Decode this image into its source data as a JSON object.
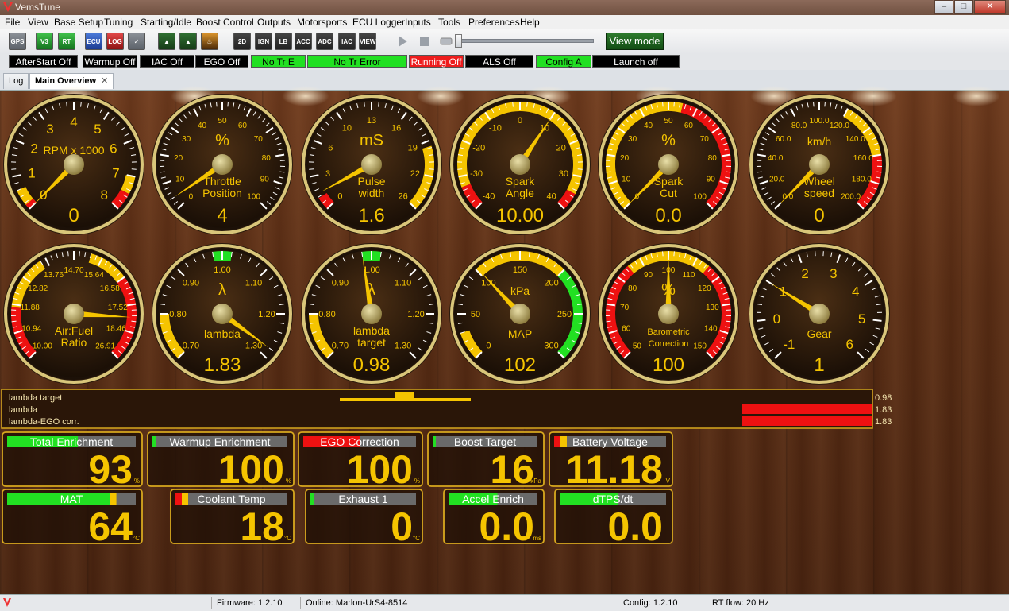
{
  "window": {
    "title": "VemsTune"
  },
  "menu": [
    "File",
    "View",
    "Base Setup",
    "Tuning",
    "Starting/Idle",
    "Boost Control",
    "Outputs",
    "Motorsports",
    "ECU Logger",
    "Inputs",
    "Tools",
    "Preferences",
    "Help"
  ],
  "toolbar": {
    "buttons": [
      {
        "name": "gps-button",
        "label": "GPS",
        "style": "grey"
      },
      {
        "name": "v3-button",
        "label": "V3",
        "style": "green"
      },
      {
        "name": "rt-button",
        "label": "RT",
        "style": "green"
      },
      {
        "name": "ecu-button",
        "label": "ECU",
        "style": "blue"
      },
      {
        "name": "log-button",
        "label": "LOG",
        "style": "red"
      },
      {
        "name": "check-button",
        "label": "✓",
        "style": "grey"
      },
      {
        "name": "tool-a-button",
        "label": "▲",
        "style": "darkgreen"
      },
      {
        "name": "tool-b-button",
        "label": "▲",
        "style": "darkgreen"
      },
      {
        "name": "fire-button",
        "label": "♨",
        "style": "fire"
      },
      {
        "name": "table-2d-button",
        "label": "2D",
        "style": "dark"
      },
      {
        "name": "table-ign-button",
        "label": "IGN",
        "style": "dark"
      },
      {
        "name": "table-lb-button",
        "label": "LB",
        "style": "dark"
      },
      {
        "name": "table-acc-button",
        "label": "ACC",
        "style": "dark"
      },
      {
        "name": "table-warm-button",
        "label": "ADC",
        "style": "dark"
      },
      {
        "name": "table-iac-button",
        "label": "IAC",
        "style": "dark"
      },
      {
        "name": "table-view-button",
        "label": "VIEW",
        "style": "dark"
      }
    ],
    "view_mode": "View mode"
  },
  "status_indicators": [
    {
      "label": "AfterStart Off",
      "color": "black"
    },
    {
      "label": "Warmup Off",
      "color": "black"
    },
    {
      "label": "IAC Off",
      "color": "black"
    },
    {
      "label": "EGO Off",
      "color": "black"
    },
    {
      "label": "No Tr E",
      "color": "green"
    },
    {
      "label": "No Tr Error",
      "color": "green"
    },
    {
      "label": "Running Off",
      "color": "red"
    },
    {
      "label": "ALS Off",
      "color": "black"
    },
    {
      "label": "Config A",
      "color": "green"
    },
    {
      "label": "Launch off",
      "color": "black"
    }
  ],
  "tabs": [
    {
      "label": "Log",
      "active": false
    },
    {
      "label": "Main Overview",
      "active": true,
      "close": "✕"
    }
  ],
  "gauges": [
    {
      "id": "rpm",
      "label": [
        "RPM x 1000"
      ],
      "unit": "",
      "ticks": [
        "0",
        "1",
        "2",
        "3",
        "4",
        "5",
        "6",
        "7",
        "8"
      ],
      "min": 0,
      "max": 8,
      "value": 0,
      "value_text": "0",
      "labelPos": "top",
      "arcs": [
        {
          "from": 0,
          "to": 0.6,
          "color": "#f5c400"
        },
        {
          "from": 0,
          "to": 0.15,
          "color": "#e11"
        },
        {
          "from": 7,
          "to": 7.5,
          "color": "#f5c400"
        },
        {
          "from": 7.5,
          "to": 8,
          "color": "#e11"
        }
      ]
    },
    {
      "id": "throttle",
      "label": [
        "Throttle",
        "Position"
      ],
      "unit": "%",
      "ticks": [
        "0",
        "10",
        "20",
        "30",
        "40",
        "50",
        "60",
        "70",
        "80",
        "90",
        "100"
      ],
      "min": 0,
      "max": 100,
      "value": 4,
      "value_text": "4",
      "labelPos": "bottom",
      "arcs": []
    },
    {
      "id": "pulse",
      "label": [
        "Pulse",
        "width"
      ],
      "unit": "mS",
      "ticks": [
        "0",
        "3",
        "6",
        "10",
        "13",
        "16",
        "19",
        "22",
        "26"
      ],
      "min": 0,
      "max": 26,
      "value": 1.6,
      "value_text": "1.6",
      "labelPos": "bottom",
      "arcs": [
        {
          "from": 0,
          "to": 1.2,
          "color": "#e11"
        },
        {
          "from": 20,
          "to": 26,
          "color": "#f5c400"
        }
      ]
    },
    {
      "id": "spark",
      "label": [
        "Spark",
        "Angle"
      ],
      "unit": "",
      "ticks": [
        "-40",
        "-30",
        "-20",
        "-10",
        "0",
        "10",
        "20",
        "30",
        "40"
      ],
      "min": -40,
      "max": 40,
      "value": 10,
      "value_text": "10.00",
      "labelPos": "bottom",
      "arcs": [
        {
          "from": -40,
          "to": -33,
          "color": "#e11"
        },
        {
          "from": -33,
          "to": 35,
          "color": "#f5c400"
        },
        {
          "from": 35,
          "to": 40,
          "color": "#e11"
        }
      ]
    },
    {
      "id": "sparkcut",
      "label": [
        "Spark",
        "Cut"
      ],
      "unit": "%",
      "ticks": [
        "0",
        "10",
        "20",
        "30",
        "40",
        "50",
        "60",
        "70",
        "80",
        "90",
        "100"
      ],
      "min": 0,
      "max": 100,
      "value": 0,
      "value_text": "0.0",
      "labelPos": "bottom",
      "arcs": [
        {
          "from": 0,
          "to": 55,
          "color": "#f5c400"
        },
        {
          "from": 55,
          "to": 100,
          "color": "#e11"
        }
      ]
    },
    {
      "id": "wheel",
      "label": [
        "Wheel",
        "speed"
      ],
      "unit": "km/h",
      "ticks": [
        "0.0",
        "20.0",
        "40.0",
        "60.0",
        "80.0",
        "100.0",
        "120.0",
        "140.0",
        "160.0",
        "180.0",
        "200.0"
      ],
      "min": 0,
      "max": 200,
      "value": 0,
      "value_text": "0",
      "labelPos": "bottom",
      "arcs": [
        {
          "from": 120,
          "to": 160,
          "color": "#f5c400"
        },
        {
          "from": 160,
          "to": 200,
          "color": "#e11"
        }
      ]
    },
    {
      "id": "afr",
      "label": [
        "Air:Fuel",
        "Ratio"
      ],
      "unit": "",
      "ticks": [
        "10.00",
        "10.94",
        "11.88",
        "12.82",
        "13.76",
        "14.70",
        "15.64",
        "16.58",
        "17.52",
        "18.46",
        "26.91"
      ],
      "min": 10,
      "max": 20,
      "value": 18.46,
      "value_text": "",
      "labelPos": "bottom",
      "arcs": [
        {
          "from": 10,
          "to": 11.9,
          "color": "#e11"
        },
        {
          "from": 11.9,
          "to": 13.8,
          "color": "#f5c400"
        },
        {
          "from": 15.6,
          "to": 17,
          "color": "#f5c400"
        },
        {
          "from": 17,
          "to": 20,
          "color": "#e11"
        }
      ]
    },
    {
      "id": "lambda",
      "label": [
        "lambda"
      ],
      "unit": "λ",
      "ticks": [
        "0.70",
        "0.80",
        "0.90",
        "1.00",
        "1.10",
        "1.20",
        "1.30"
      ],
      "min": 0.7,
      "max": 1.3,
      "value": 1.28,
      "value_text": "1.83",
      "labelPos": "bottom",
      "arcs": [
        {
          "from": 0.7,
          "to": 0.8,
          "color": "#f5c400"
        },
        {
          "from": 0.98,
          "to": 1.02,
          "color": "#22e022"
        }
      ]
    },
    {
      "id": "lambdatarget",
      "label": [
        "lambda",
        "target"
      ],
      "unit": "λ",
      "ticks": [
        "0.70",
        "0.80",
        "0.90",
        "1.00",
        "1.10",
        "1.20",
        "1.30"
      ],
      "min": 0.7,
      "max": 1.3,
      "value": 0.98,
      "value_text": "0.98",
      "labelPos": "bottom",
      "arcs": [
        {
          "from": 0.7,
          "to": 0.8,
          "color": "#f5c400"
        },
        {
          "from": 0.98,
          "to": 1.02,
          "color": "#22e022"
        }
      ]
    },
    {
      "id": "map",
      "label": [
        "MAP"
      ],
      "unit": "kPa",
      "ticks": [
        "0",
        "50",
        "100",
        "150",
        "200",
        "250",
        "300"
      ],
      "min": 0,
      "max": 300,
      "value": 102,
      "value_text": "102",
      "labelPos": "bottom",
      "arcs": [
        {
          "from": 0,
          "to": 30,
          "color": "#f5c400"
        },
        {
          "from": 100,
          "to": 200,
          "color": "#f5c400"
        },
        {
          "from": 200,
          "to": 300,
          "color": "#22e022"
        }
      ]
    },
    {
      "id": "baro",
      "label": [
        "Barometric",
        "Correction"
      ],
      "unit": "%",
      "ticks": [
        "50",
        "60",
        "70",
        "80",
        "90",
        "100",
        "110",
        "120",
        "130",
        "140",
        "150"
      ],
      "min": 50,
      "max": 150,
      "value": 100,
      "value_text": "100",
      "labelPos": "bottom",
      "arcs": [
        {
          "from": 50,
          "to": 85,
          "color": "#e11"
        },
        {
          "from": 85,
          "to": 115,
          "color": "#f5c400"
        },
        {
          "from": 115,
          "to": 150,
          "color": "#e11"
        }
      ]
    },
    {
      "id": "gear",
      "label": [
        "Gear"
      ],
      "unit": "",
      "ticks": [
        "-1",
        "0",
        "1",
        "2",
        "3",
        "4",
        "5",
        "6"
      ],
      "min": -1,
      "max": 6,
      "value": 1,
      "value_text": "1",
      "labelPos": "bottom",
      "arcs": []
    }
  ],
  "bars": {
    "rows": [
      {
        "label": "lambda target",
        "value": "0.98"
      },
      {
        "label": "lambda",
        "value": "1.83"
      },
      {
        "label": "lambda-EGO corr.",
        "value": "1.83"
      }
    ]
  },
  "numeric_boxes": [
    {
      "name": "total-enrichment",
      "label": "Total Enrichment",
      "value": "93",
      "unit": "%",
      "bar": "green"
    },
    {
      "name": "warmup-enrichment",
      "label": "Warmup Enrichment",
      "value": "100",
      "unit": "%",
      "bar": "grey"
    },
    {
      "name": "ego-correction",
      "label": "EGO Correction",
      "value": "100",
      "unit": "%",
      "bar": "red"
    },
    {
      "name": "boost-target",
      "label": "Boost Target",
      "value": "16",
      "unit": "kPa",
      "bar": "grey"
    },
    {
      "name": "battery-voltage",
      "label": "Battery Voltage",
      "value": "11.18",
      "unit": "V",
      "bar": "redyellow"
    },
    {
      "name": "mat",
      "label": "MAT",
      "value": "64",
      "unit": "°C",
      "bar": "greenyellow"
    },
    {
      "name": "coolant-temp",
      "label": "Coolant Temp",
      "value": "18",
      "unit": "°C",
      "bar": "redyellow"
    },
    {
      "name": "exhaust-1",
      "label": "Exhaust 1",
      "value": "0",
      "unit": "°C",
      "bar": "grey"
    },
    {
      "name": "accel-enrich",
      "label": "Accel Enrich",
      "value": "0.0",
      "unit": "ms",
      "bar": "green"
    },
    {
      "name": "dtps-dt",
      "label": "dTPS/dt",
      "value": "0.0",
      "unit": "",
      "bar": "green"
    }
  ],
  "footer": {
    "firmware": "Firmware: 1.2.10",
    "online": "Online: Marlon-UrS4-8514",
    "config": "Config: 1.2.10",
    "rtflow": "RT flow: 20 Hz"
  },
  "colors": {
    "gold": "#f5c400",
    "red": "#e11",
    "green": "#22e022",
    "wood": "#5a2d14"
  }
}
